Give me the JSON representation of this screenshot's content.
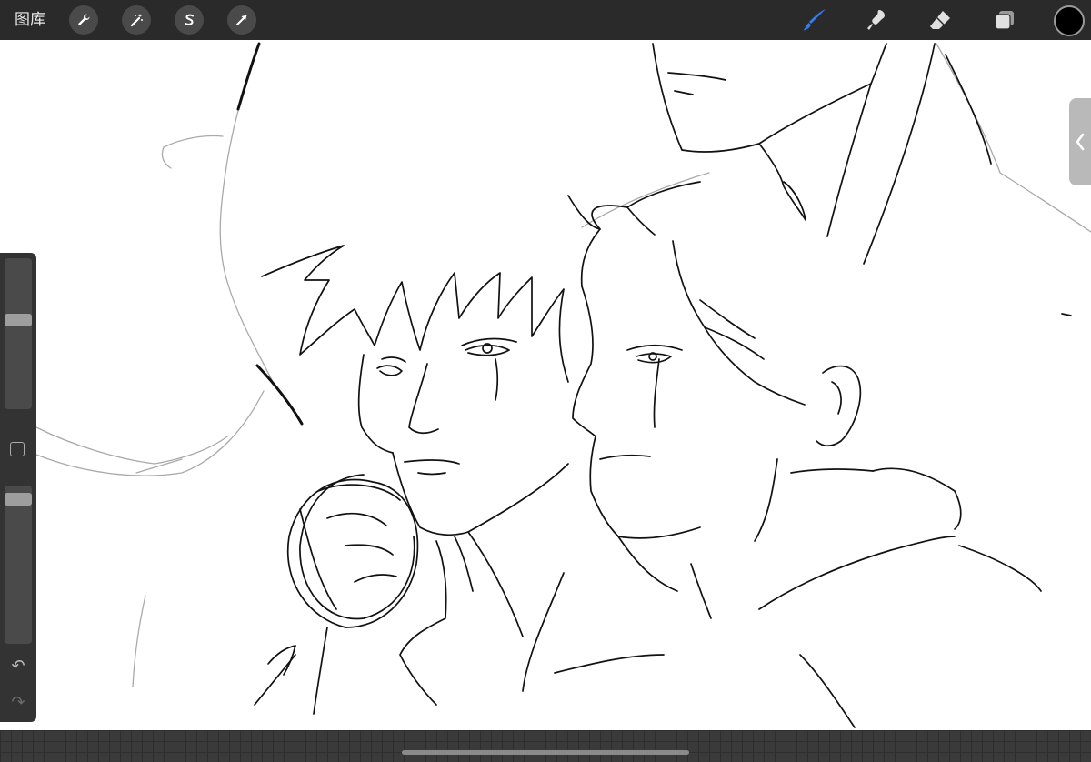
{
  "topbar": {
    "gallery_label": "图库",
    "left_tools": [
      {
        "icon": "wrench-icon",
        "name": "actions"
      },
      {
        "icon": "magic-wand-icon",
        "name": "adjustments"
      },
      {
        "icon": "selection-s-icon",
        "name": "selection"
      },
      {
        "icon": "arrow-cursor-icon",
        "name": "transform"
      }
    ],
    "right_tools": [
      {
        "icon": "brush-icon",
        "name": "brush",
        "active": true
      },
      {
        "icon": "smudge-icon",
        "name": "smudge",
        "active": false
      },
      {
        "icon": "eraser-icon",
        "name": "eraser",
        "active": false
      },
      {
        "icon": "layers-icon",
        "name": "layers",
        "active": false
      }
    ],
    "current_color": "#000000"
  },
  "sidebar": {
    "brush_size_level": 0.6,
    "opacity_level": 0.95,
    "modify_icon": "square-icon",
    "undo_icon": "undo-arrow-icon",
    "redo_icon": "redo-arrow-icon",
    "undo_glyph": "↶",
    "redo_glyph": "↷"
  },
  "right_panel": {
    "tab_icon": "chevron-left-icon"
  },
  "colors": {
    "toolbar_bg": "#2a2a2a",
    "active_accent": "#2f7ef5",
    "canvas_bg": "#ffffff"
  }
}
